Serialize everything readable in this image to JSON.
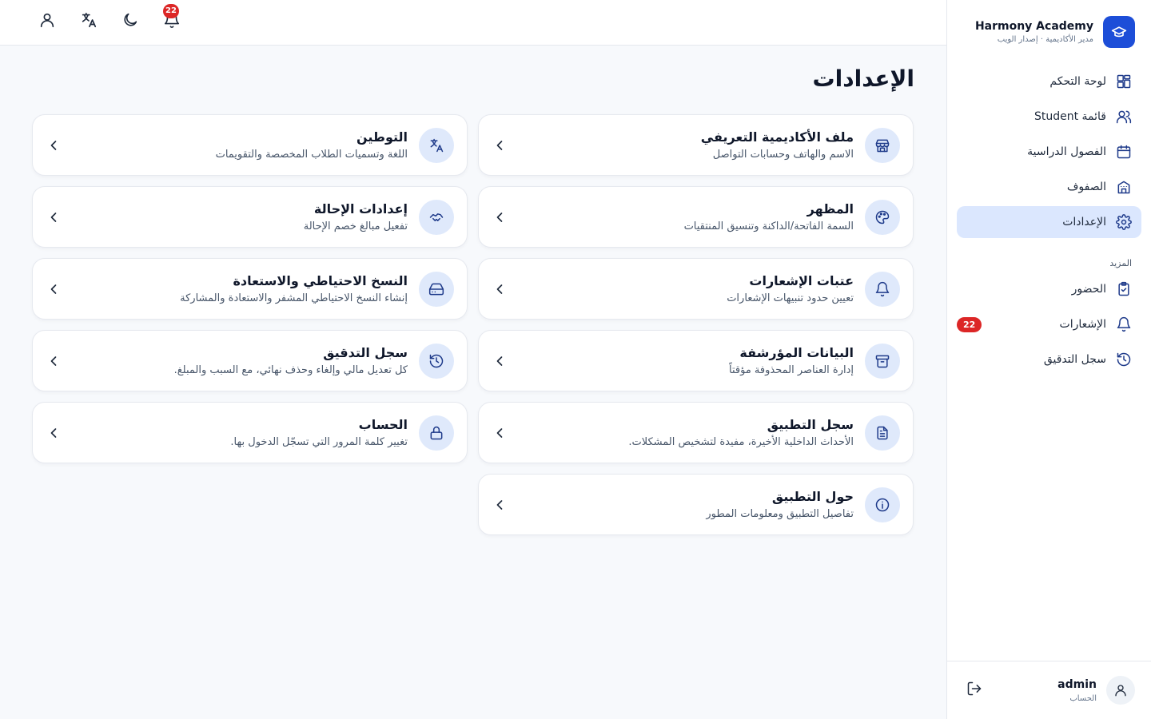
{
  "brand": {
    "title": "Harmony Academy",
    "subtitle": "مدير الأكاديمية · إصدار الويب",
    "icon": "graduation-cap-icon",
    "accent": "#1d4ed8"
  },
  "topbar": {
    "notification_count": "22",
    "icons": [
      "bell-icon",
      "moon-icon",
      "translate-icon",
      "user-icon"
    ]
  },
  "sidebar": {
    "items": [
      {
        "label": "لوحة التحكم",
        "icon": "dashboard-icon"
      },
      {
        "label": "قائمة Student",
        "icon": "users-icon"
      },
      {
        "label": "الفصول الدراسية",
        "icon": "calendar-icon"
      },
      {
        "label": "الصفوف",
        "icon": "building-icon"
      },
      {
        "label": "الإعدادات",
        "icon": "gear-icon",
        "active": true
      }
    ],
    "section_label": "المزيد",
    "more_items": [
      {
        "label": "الحضور",
        "icon": "clipboard-check-icon"
      },
      {
        "label": "الإشعارات",
        "icon": "bell-icon",
        "badge": "22"
      },
      {
        "label": "سجل التدقيق",
        "icon": "history-icon"
      }
    ]
  },
  "account": {
    "name": "admin",
    "subtitle": "الحساب"
  },
  "main": {
    "title": "الإعدادات",
    "cards": [
      {
        "title": "ملف الأكاديمية التعريفي",
        "desc": "الاسم والهاتف وحسابات التواصل",
        "icon": "store-icon"
      },
      {
        "title": "التوطين",
        "desc": "اللغة وتسميات الطلاب المخصصة والتقويمات",
        "icon": "translate-icon"
      },
      {
        "title": "المظهر",
        "desc": "السمة الفاتحة/الداكنة وتنسيق المنتقيات",
        "icon": "palette-icon"
      },
      {
        "title": "إعدادات الإحالة",
        "desc": "تفعيل مبالغ خصم الإحالة",
        "icon": "handshake-icon"
      },
      {
        "title": "عتبات الإشعارات",
        "desc": "تعيين حدود تنبيهات الإشعارات",
        "icon": "bell-icon"
      },
      {
        "title": "النسخ الاحتياطي والاستعادة",
        "desc": "إنشاء النسخ الاحتياطي المشفر والاستعادة والمشاركة",
        "icon": "hard-drive-icon"
      },
      {
        "title": "البيانات المؤرشفة",
        "desc": "إدارة العناصر المحذوفة مؤقتاً",
        "icon": "archive-icon"
      },
      {
        "title": "سجل التدقيق",
        "desc": "كل تعديل مالي وإلغاء وحذف نهائي، مع السبب والمبلغ.",
        "icon": "history-icon"
      },
      {
        "title": "سجل التطبيق",
        "desc": "الأحداث الداخلية الأخيرة، مفيدة لتشخيص المشكلات.",
        "icon": "file-text-icon"
      },
      {
        "title": "الحساب",
        "desc": "تغيير كلمة المرور التي تسجّل الدخول بها.",
        "icon": "lock-icon"
      },
      {
        "title": "حول التطبيق",
        "desc": "تفاصيل التطبيق ومعلومات المطور",
        "icon": "info-icon"
      }
    ]
  }
}
